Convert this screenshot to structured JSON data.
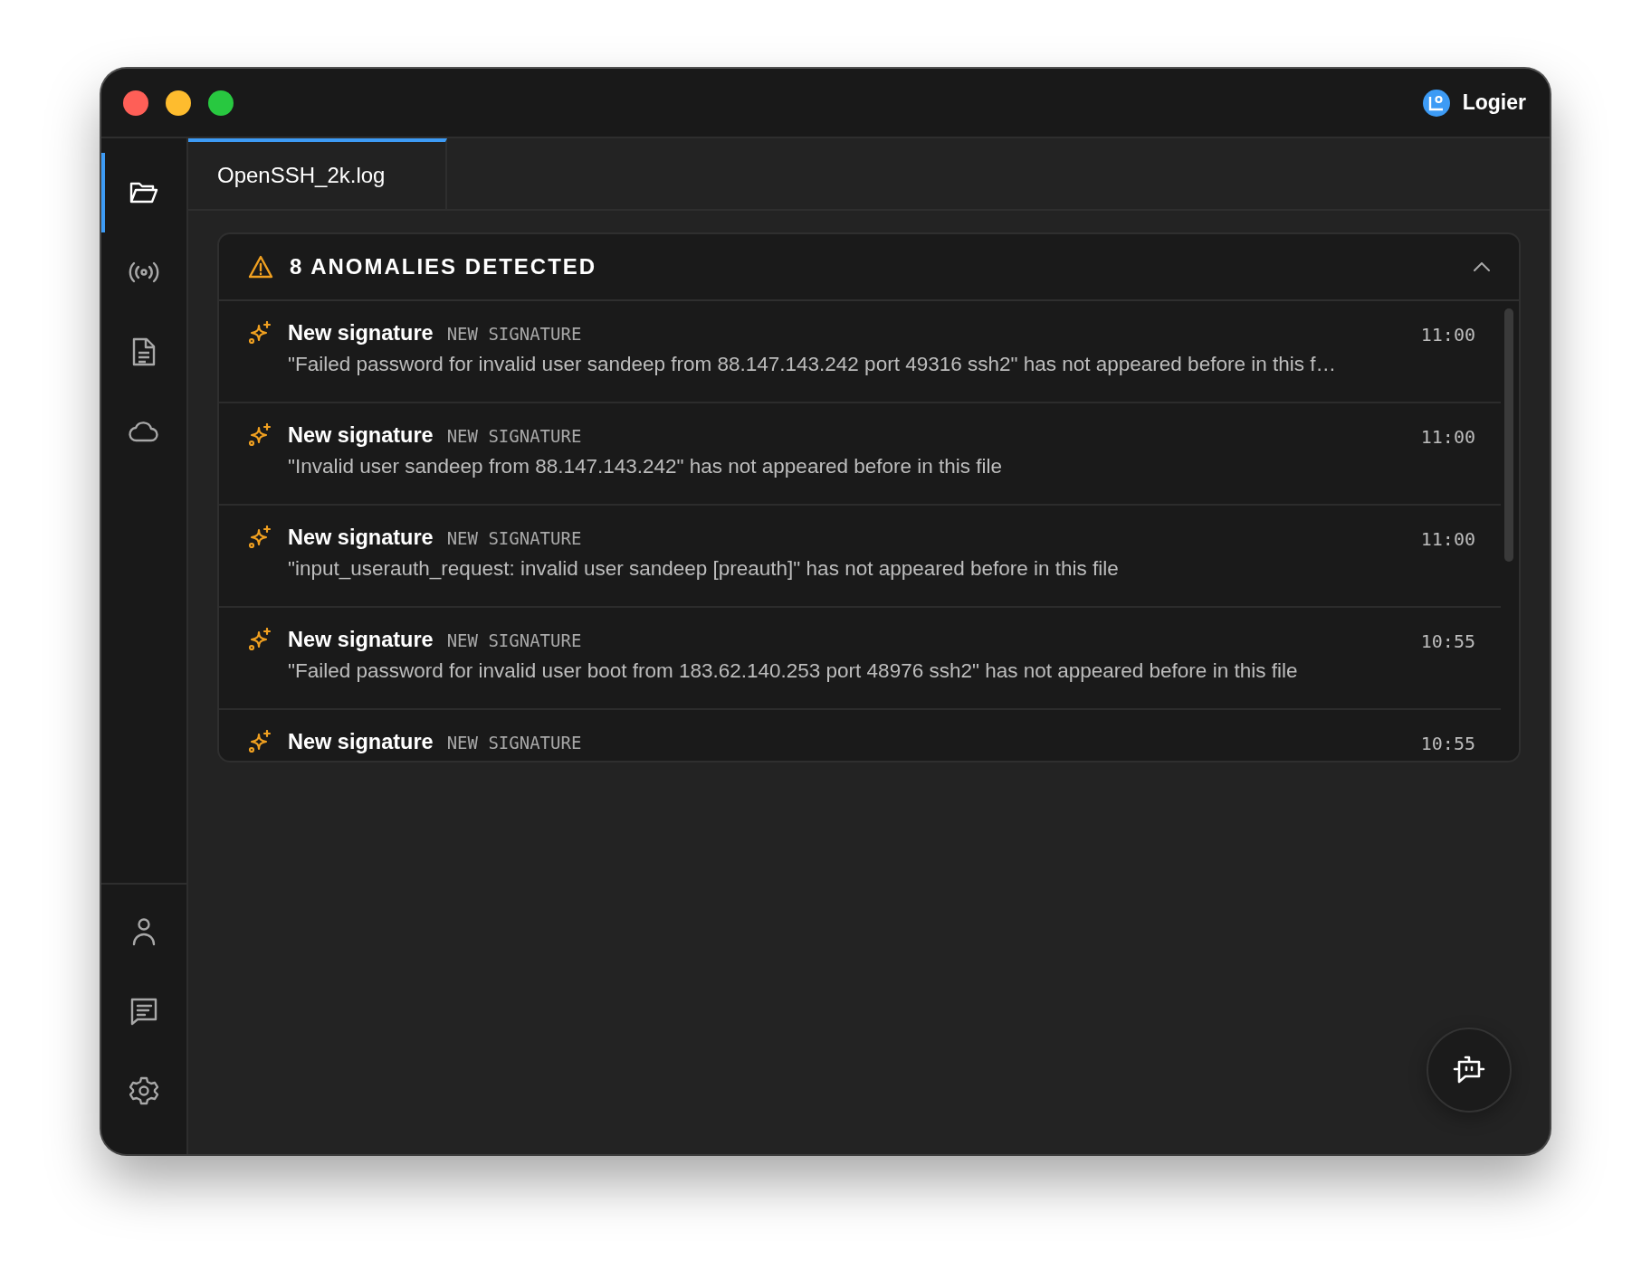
{
  "window": {
    "app_name": "Logier"
  },
  "sidebar": {
    "top_items": [
      {
        "kind": "folder",
        "selected": true
      },
      {
        "kind": "broadcast",
        "selected": false
      },
      {
        "kind": "document",
        "selected": false
      },
      {
        "kind": "cloud",
        "selected": false
      }
    ],
    "bottom_items": [
      {
        "kind": "user",
        "selected": false
      },
      {
        "kind": "chat",
        "selected": false
      },
      {
        "kind": "settings",
        "selected": false
      }
    ]
  },
  "tabs": [
    {
      "label": "OpenSSH_2k.log",
      "selected": true
    }
  ],
  "anomalies": {
    "title": "8 ANOMALIES DETECTED",
    "expanded": true,
    "items": [
      {
        "title": "New signature",
        "tag": "NEW SIGNATURE",
        "time": "11:00",
        "description": "\"Failed password for invalid user sandeep from 88.147.143.242 port 49316 ssh2\" has not appeared before in this f…"
      },
      {
        "title": "New signature",
        "tag": "NEW SIGNATURE",
        "time": "11:00",
        "description": "\"Invalid user sandeep from 88.147.143.242\" has not appeared before in this file"
      },
      {
        "title": "New signature",
        "tag": "NEW SIGNATURE",
        "time": "11:00",
        "description": "\"input_userauth_request: invalid user sandeep [preauth]\" has not appeared before in this file"
      },
      {
        "title": "New signature",
        "tag": "NEW SIGNATURE",
        "time": "10:55",
        "description": "\"Failed password for invalid user boot from 183.62.140.253 port 48976 ssh2\" has not appeared before in this file"
      },
      {
        "title": "New signature",
        "tag": "NEW SIGNATURE",
        "time": "10:55"
      }
    ]
  }
}
